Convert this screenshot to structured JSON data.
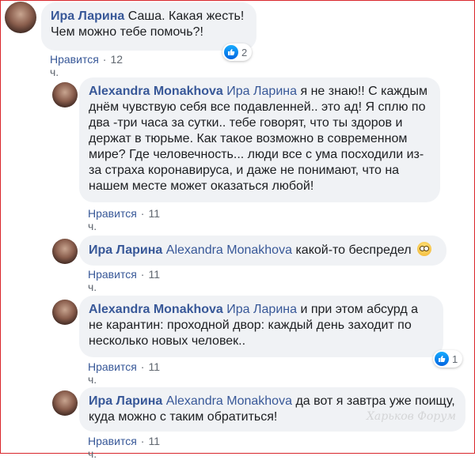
{
  "comments": [
    {
      "author": "Ира Ларина",
      "mention": "",
      "text": "Саша. Какая жесть!\nЧем можно тебе помочь?!",
      "like_label": "Нравится",
      "time": "12 ч.",
      "reactions": "2"
    },
    {
      "author": "Alexandra Monakhova",
      "mention": "Ира Ларина",
      "text": "я не знаю!! С каждым днём чувствую себя все подавленней.. это ад! Я сплю по два -три часа за сутки.. тебе говорят, что ты здоров и держат в тюрьме. Как такое возможно в современном мире? Где человечность... люди все с ума посходили из-за страха коронавируса, и даже не понимают, что на нашем месте может оказаться любой!",
      "like_label": "Нравится",
      "time": "11 ч."
    },
    {
      "author": "Ира Ларина",
      "mention": "Alexandra Monakhova",
      "text": "какой-то беспредел",
      "emoji": "face-with-rolling-eyes",
      "like_label": "Нравится",
      "time": "11 ч."
    },
    {
      "author": "Alexandra Monakhova",
      "mention": "Ира Ларина",
      "text": "и при этом абсурд а не карантин: проходной двор: каждый день заходит по несколько новых человек..",
      "like_label": "Нравится",
      "time": "11 ч.",
      "reactions": "1"
    },
    {
      "author": "Ира Ларина",
      "mention": "Alexandra Monakhova",
      "text": "да вот я завтра уже поищу, куда можно с таким обратиться!",
      "like_label": "Нравится",
      "time": "11 ч."
    }
  ],
  "watermark": "Харьков Форум",
  "colors": {
    "link": "#385898",
    "bubble": "#f0f2f5",
    "like": "#1877f2",
    "frame": "#d9262b"
  }
}
